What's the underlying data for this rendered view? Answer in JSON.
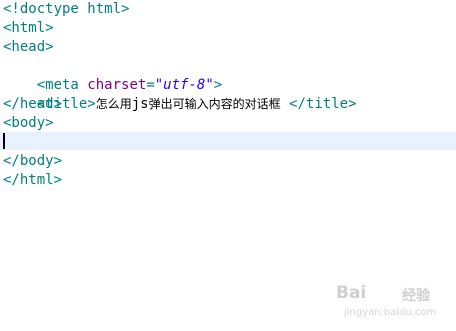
{
  "editor": {
    "lines": [
      "<!doctype html>",
      "<html>",
      "<head>",
      "<meta charset=\"utf-8\">",
      "<title>怎么用js弹出可输入内容的对话框 </title>",
      "</head>",
      "<body>",
      "",
      "</body>",
      "</html>"
    ],
    "line3_parts": {
      "open": "<meta ",
      "attr": "charset",
      "equals": "=",
      "value": "\"utf-8\"",
      "close": ">"
    },
    "line4_parts": {
      "open_tag": "<title>",
      "text_before": "怎么用",
      "text_latin": "js",
      "text_after": "弹出可输入内容的对话框",
      "close_tag": " </title>"
    },
    "current_line_index": 7
  },
  "watermark": {
    "main": "Bai",
    "sub": "经验",
    "url": "jingyan.baidu.com"
  },
  "colors": {
    "tag": "#008080",
    "attribute": "#7f007f",
    "value": "#2a00ff",
    "text": "#000000",
    "current_line_highlight": "#e8f2fe"
  }
}
